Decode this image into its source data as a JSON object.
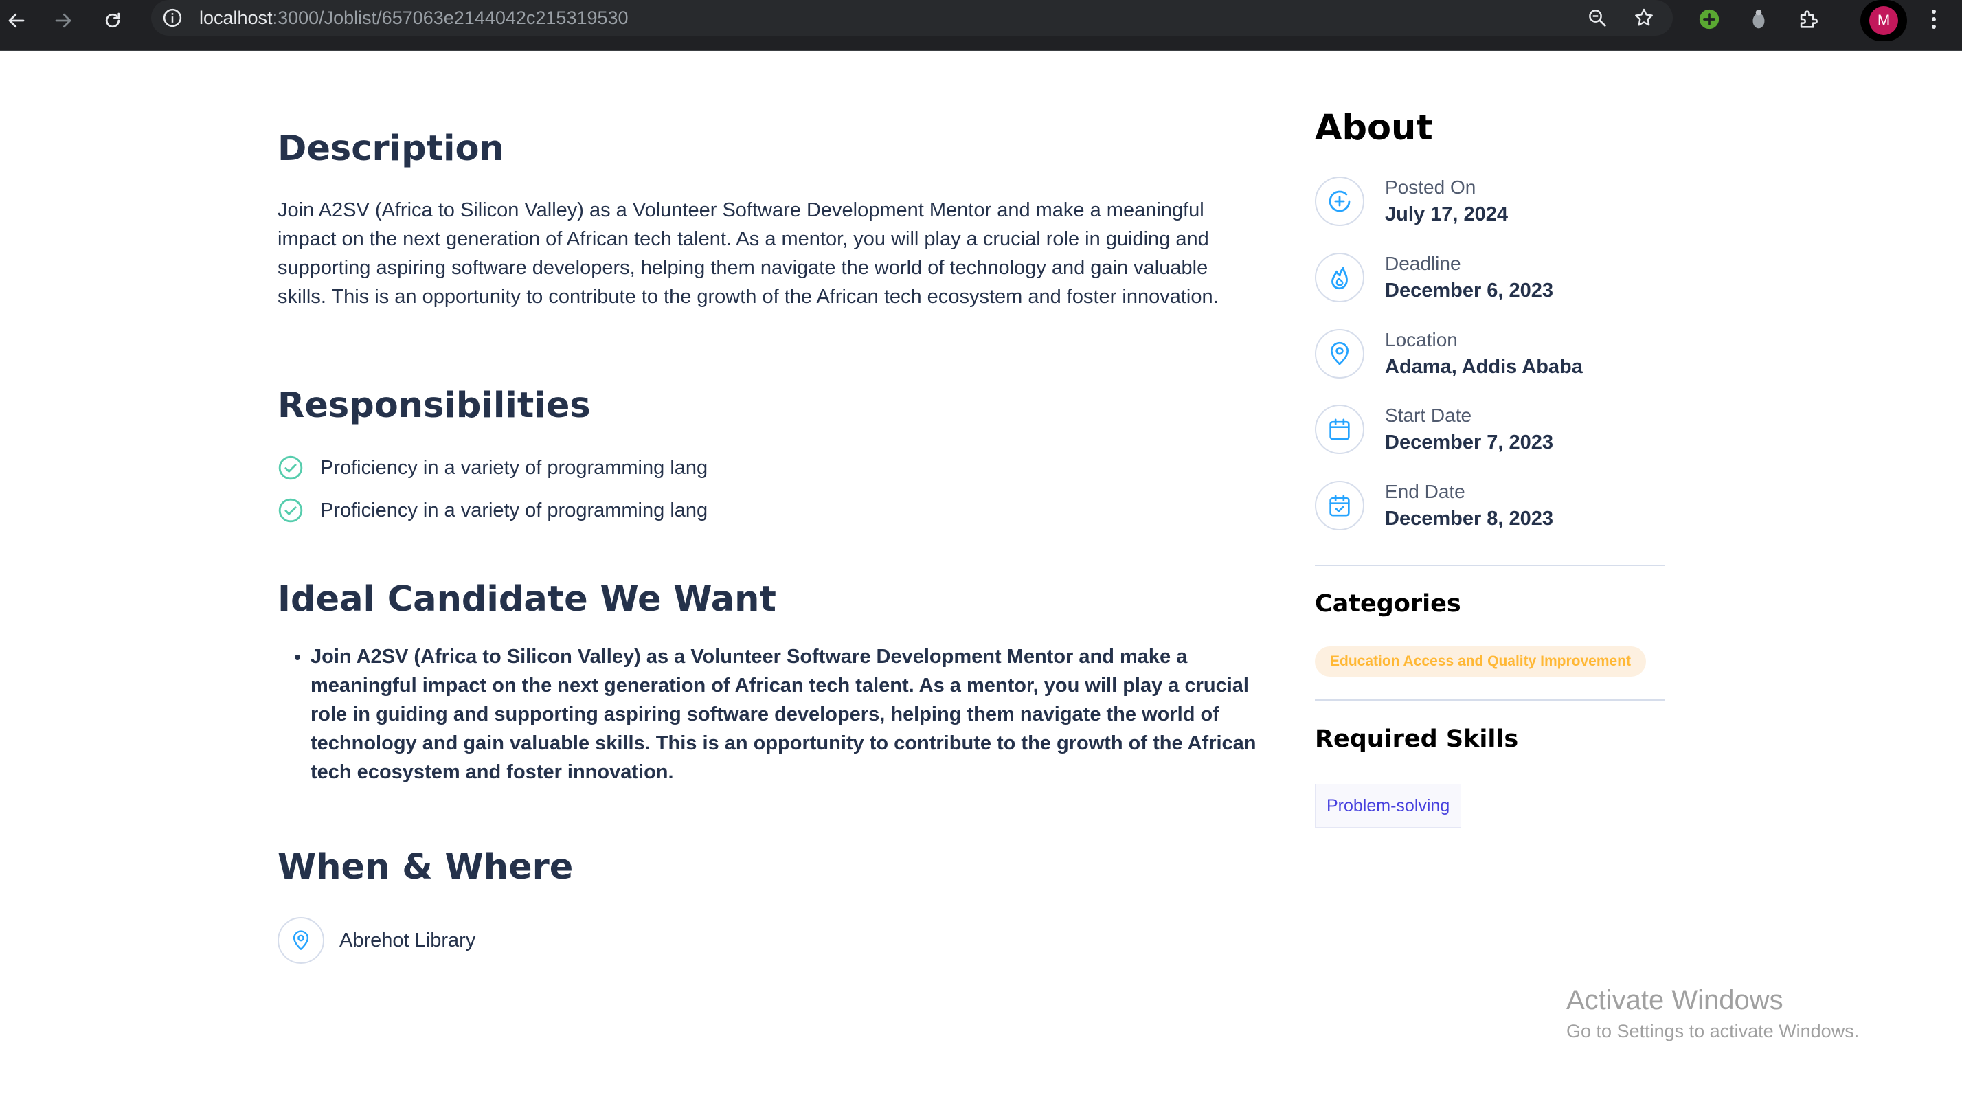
{
  "browser": {
    "url_host": "localhost",
    "url_path": ":3000/Joblist/657063e2144042c215319530",
    "profile_initial": "M",
    "icons": [
      "back-icon",
      "forward-icon",
      "reload-icon",
      "site-info-icon",
      "zoom-icon",
      "bookmark-star-icon",
      "extension-add-icon",
      "extension-icon",
      "extensions-puzzle-icon",
      "menu-dots-icon"
    ]
  },
  "description": {
    "title": "Description",
    "text": "Join A2SV (Africa to Silicon Valley) as a Volunteer Software Development Mentor and make a meaningful impact on the next generation of African tech talent. As a mentor, you will play a crucial role in guiding and supporting aspiring software developers, helping them navigate the world of technology and gain valuable skills. This is an opportunity to contribute to the growth of the African tech ecosystem and foster innovation."
  },
  "responsibilities": {
    "title": "Responsibilities",
    "items": [
      "Proficiency in a variety of programming lang",
      "Proficiency in a variety of programming lang"
    ]
  },
  "ideal_candidate": {
    "title": "Ideal Candidate We Want",
    "items": [
      "Join A2SV (Africa to Silicon Valley) as a Volunteer Software Development Mentor and make a meaningful impact on the next generation of African tech talent. As a mentor, you will play a crucial role in guiding and supporting aspiring software developers, helping them navigate the world of technology and gain valuable skills. This is an opportunity to contribute to the growth of the African tech ecosystem and foster innovation."
    ]
  },
  "when_where": {
    "title": "When & Where",
    "location": "Abrehot Library"
  },
  "about": {
    "title": "About",
    "items": [
      {
        "label": "Posted On",
        "value": "July 17, 2024",
        "icon": "plus-circle-icon"
      },
      {
        "label": "Deadline",
        "value": "December 6, 2023",
        "icon": "fire-icon"
      },
      {
        "label": "Location",
        "value": "Adama, Addis Ababa",
        "icon": "location-pin-icon"
      },
      {
        "label": "Start Date",
        "value": "December 7, 2023",
        "icon": "calendar-icon"
      },
      {
        "label": "End Date",
        "value": "December 8, 2023",
        "icon": "calendar-check-icon"
      }
    ]
  },
  "categories": {
    "title": "Categories",
    "items": [
      "Education Access and Quality Improvement"
    ]
  },
  "required_skills": {
    "title": "Required Skills",
    "items": [
      "Problem-solving"
    ]
  },
  "watermark": {
    "line1": "Activate Windows",
    "line2": "Go to Settings to activate Windows."
  },
  "colors": {
    "heading": "#25324B",
    "accent_blue": "#26A4FF",
    "check_green": "#56CDAD",
    "category_text": "#FFB836",
    "category_bg": "#FDF0E0",
    "skill_text": "#4640DE",
    "chrome_bg": "#202124"
  }
}
